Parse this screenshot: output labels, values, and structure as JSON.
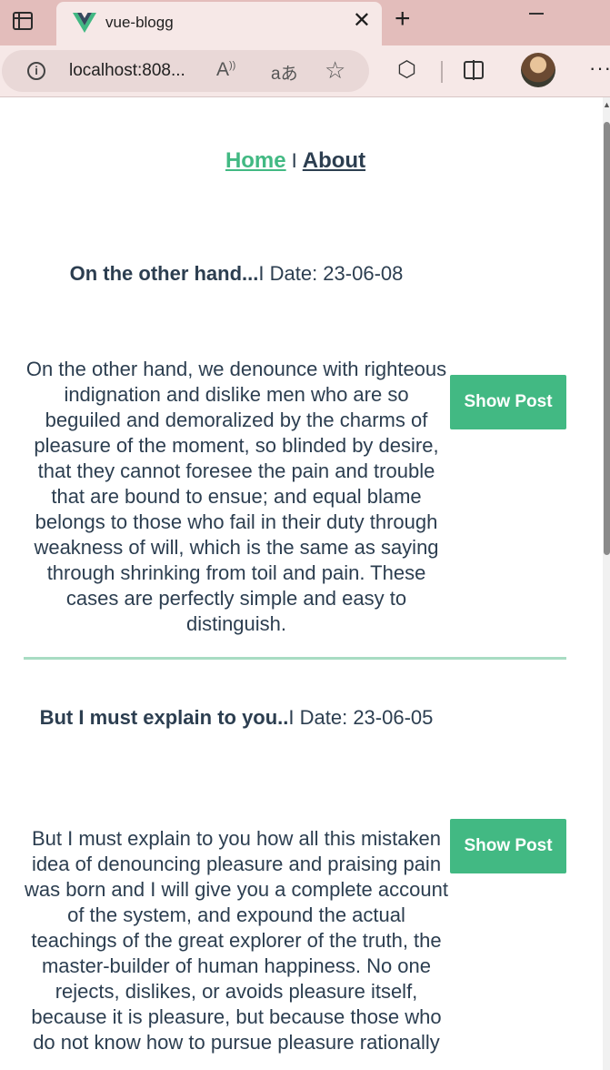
{
  "browser": {
    "tab_title": "vue-blogg",
    "url": "localhost:808...",
    "new_tab_label": "+",
    "close_label": "✕"
  },
  "nav": {
    "home": "Home",
    "divider": "I",
    "about": "About"
  },
  "posts": [
    {
      "title": "On the other hand...",
      "date_label": "I Date: 23-06-08",
      "body": "On the other hand, we denounce with righteous indignation and dislike men who are so beguiled and demoralized by the charms of pleasure of the moment, so blinded by desire, that they cannot foresee the pain and trouble that are bound to ensue; and equal blame belongs to those who fail in their duty through weakness of will, which is the same as saying through shrinking from toil and pain. These cases are perfectly simple and easy to distinguish.",
      "button": "Show Post"
    },
    {
      "title": "But I must explain to you..",
      "date_label": "I Date: 23-06-05",
      "body": "But I must explain to you how all this mistaken idea of denouncing pleasure and praising pain was born and I will give you a complete account of the system, and expound the actual teachings of the great explorer of the truth, the master-builder of human happiness. No one rejects, dislikes, or avoids pleasure itself, because it is pleasure, but because those who do not know how to pursue pleasure rationally",
      "button": "Show Post"
    }
  ],
  "colors": {
    "accent": "#42b983",
    "text": "#2c3e50",
    "tabbar": "#e3bdbb"
  }
}
